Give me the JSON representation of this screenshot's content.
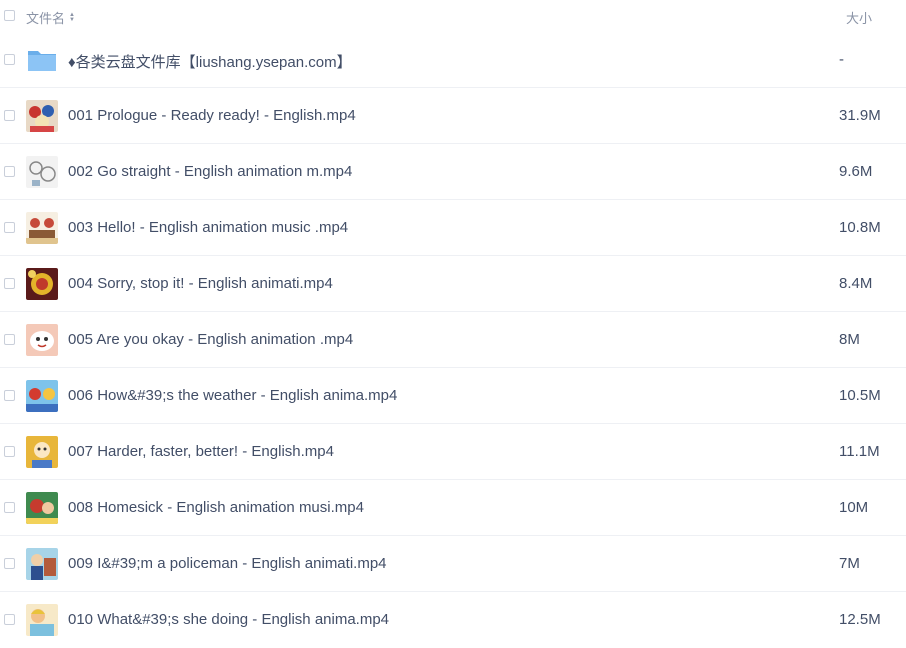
{
  "header": {
    "name_label": "文件名",
    "size_label": "大小"
  },
  "rows": [
    {
      "name": "♦各类云盘文件库【liushang.ysepan.com】",
      "size": "-",
      "type": "folder"
    },
    {
      "name": "001 Prologue - Ready ready! - English.mp4",
      "size": "31.9M",
      "type": "video"
    },
    {
      "name": "002 Go straight - English animation m.mp4",
      "size": "9.6M",
      "type": "video"
    },
    {
      "name": "003 Hello! - English animation music .mp4",
      "size": "10.8M",
      "type": "video"
    },
    {
      "name": "004 Sorry, stop it! - English animati.mp4",
      "size": "8.4M",
      "type": "video"
    },
    {
      "name": "005 Are you okay - English animation .mp4",
      "size": "8M",
      "type": "video"
    },
    {
      "name": "006 How&#39;s the weather - English anima.mp4",
      "size": "10.5M",
      "type": "video"
    },
    {
      "name": "007 Harder, faster, better! - English.mp4",
      "size": "11.1M",
      "type": "video"
    },
    {
      "name": "008 Homesick - English animation musi.mp4",
      "size": "10M",
      "type": "video"
    },
    {
      "name": "009 I&#39;m a policeman - English animati.mp4",
      "size": "7M",
      "type": "video"
    },
    {
      "name": "010 What&#39;s she doing - English anima.mp4",
      "size": "12.5M",
      "type": "video"
    }
  ],
  "colors": {
    "folder": "#7ab8f2",
    "text": "#424e67",
    "muted": "#8a93a6"
  }
}
